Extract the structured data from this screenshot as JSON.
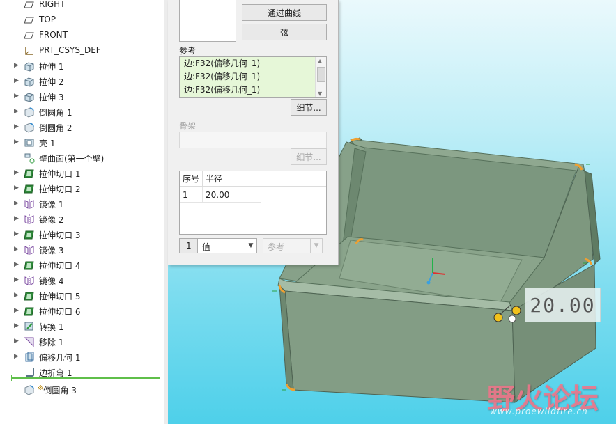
{
  "model_tree": {
    "items": [
      {
        "label": "RIGHT",
        "icon": "datum-plane-icon",
        "expandable": false
      },
      {
        "label": "TOP",
        "icon": "datum-plane-icon",
        "expandable": false
      },
      {
        "label": "FRONT",
        "icon": "datum-plane-icon",
        "expandable": false
      },
      {
        "label": "PRT_CSYS_DEF",
        "icon": "coordinate-system-icon",
        "expandable": false
      },
      {
        "label": "拉伸 1",
        "icon": "extrude-icon",
        "expandable": true
      },
      {
        "label": "拉伸 2",
        "icon": "extrude-icon",
        "expandable": true
      },
      {
        "label": "拉伸 3",
        "icon": "extrude-icon",
        "expandable": true
      },
      {
        "label": "倒圆角 1",
        "icon": "round-icon",
        "expandable": true
      },
      {
        "label": "倒圆角 2",
        "icon": "round-icon",
        "expandable": true
      },
      {
        "label": "壳 1",
        "icon": "shell-icon",
        "expandable": true
      },
      {
        "label": "壁曲面(第一个壁)",
        "icon": "wall-surface-icon",
        "expandable": false
      },
      {
        "label": "拉伸切口 1",
        "icon": "extrude-cut-icon",
        "expandable": true
      },
      {
        "label": "拉伸切口 2",
        "icon": "extrude-cut-icon",
        "expandable": true
      },
      {
        "label": "镜像 1",
        "icon": "mirror-icon",
        "expandable": true
      },
      {
        "label": "镜像 2",
        "icon": "mirror-icon",
        "expandable": true
      },
      {
        "label": "拉伸切口 3",
        "icon": "extrude-cut-icon",
        "expandable": true
      },
      {
        "label": "镜像 3",
        "icon": "mirror-icon",
        "expandable": true
      },
      {
        "label": "拉伸切口 4",
        "icon": "extrude-cut-icon",
        "expandable": true
      },
      {
        "label": "镜像 4",
        "icon": "mirror-icon",
        "expandable": true
      },
      {
        "label": "拉伸切口 5",
        "icon": "extrude-cut-icon",
        "expandable": true
      },
      {
        "label": "拉伸切口 6",
        "icon": "extrude-cut-icon",
        "expandable": true
      },
      {
        "label": "转换 1",
        "icon": "convert-icon",
        "expandable": true
      },
      {
        "label": "移除 1",
        "icon": "remove-icon",
        "expandable": true
      },
      {
        "label": "偏移几何 1",
        "icon": "offset-geometry-icon",
        "expandable": true
      },
      {
        "label": "边折弯 1",
        "icon": "edge-bend-icon",
        "expandable": false
      }
    ],
    "active_feature": {
      "label": "倒圆角 3",
      "marker": "※",
      "icon": "round-icon"
    }
  },
  "panel": {
    "buttons": {
      "through_curve": "通过曲线",
      "chord": "弦"
    },
    "references": {
      "title": "参考",
      "items": [
        "边:F32(偏移几何_1)",
        "边:F32(偏移几何_1)",
        "边:F32(偏移几何_1)"
      ],
      "details_button": "细节..."
    },
    "skeleton": {
      "title": "骨架",
      "details_button": "细节..."
    },
    "radius_table": {
      "headers": [
        "序号",
        "半径"
      ],
      "rows": [
        {
          "index": "1",
          "radius": "20.00"
        }
      ]
    },
    "bottom": {
      "row_number": "1",
      "value_type": "值",
      "reference": "参考"
    }
  },
  "viewport": {
    "dimension_label": "20.00",
    "watermark": "野火论坛",
    "watermark_url": "www.proewildfire.cn"
  }
}
